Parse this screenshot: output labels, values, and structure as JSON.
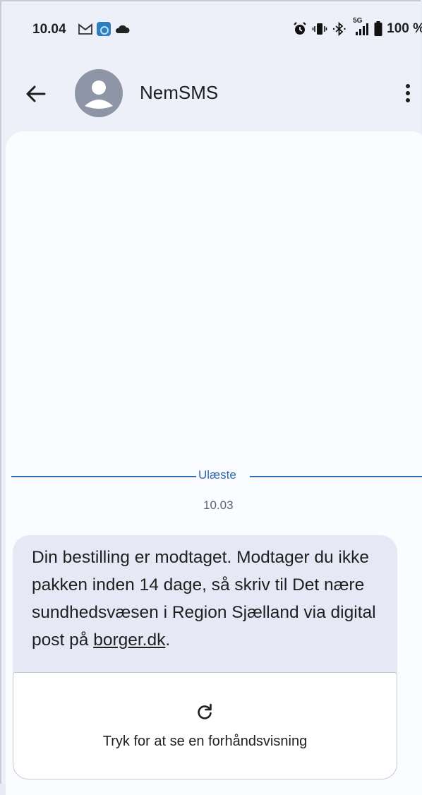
{
  "status_bar": {
    "time": "10.04",
    "battery_text": "100 %",
    "network_label": "5G",
    "icons": [
      "gmail-icon",
      "app-icon",
      "cloud-icon",
      "alarm-icon",
      "vibrate-icon",
      "bluetooth-icon",
      "signal-icon",
      "battery-icon"
    ]
  },
  "header": {
    "contact_name": "NemSMS"
  },
  "conversation": {
    "unread_label": "Ulæste",
    "timestamp": "10.03",
    "message": {
      "text_part1": "Din bestilling er modtaget. Modtager du ikke pakken inden 14 dage, så skriv til Det nære sundhedsvæsen i Region Sjælland via digital post på ",
      "link_text": "borger.dk",
      "text_end": "."
    },
    "preview": {
      "label": "Tryk for at se en forhåndsvisning"
    }
  },
  "colors": {
    "accent": "#2f6bb0",
    "background": "#eef0f9",
    "bubble": "#e6e9f5"
  }
}
